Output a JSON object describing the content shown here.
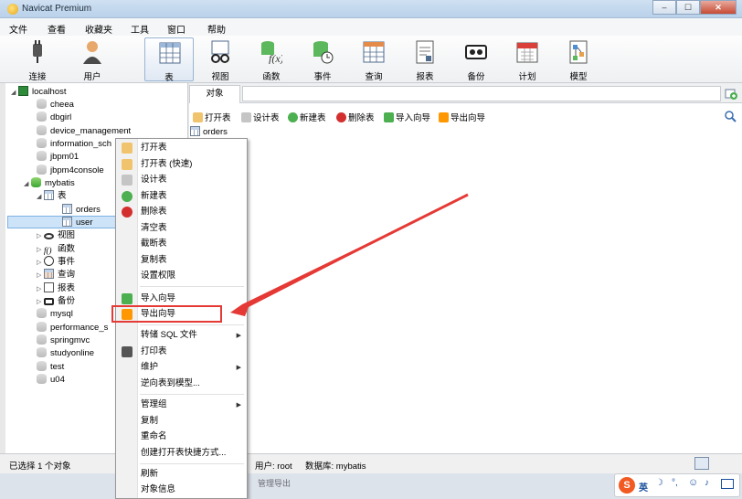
{
  "window": {
    "title": "Navicat Premium"
  },
  "menubar": [
    "文件",
    "查看",
    "收藏夹",
    "工具",
    "窗口",
    "帮助"
  ],
  "toolbar": [
    "连接",
    "用户",
    "表",
    "视图",
    "函数",
    "事件",
    "查询",
    "报表",
    "备份",
    "计划",
    "模型"
  ],
  "tree": {
    "root": "localhost",
    "databases_before": [
      "cheea",
      "dbgirl",
      "device_management",
      "information_sch",
      "jbpm01",
      "jbpm4console"
    ],
    "open_db": "mybatis",
    "tables_node": "表",
    "tables": [
      "orders",
      "user"
    ],
    "other_nodes": [
      "视图",
      "函数",
      "事件",
      "查询",
      "报表",
      "备份"
    ],
    "databases_after": [
      "mysql",
      "performance_s",
      "springmvc",
      "studyonline",
      "test",
      "u04"
    ]
  },
  "content": {
    "tab": "对象",
    "actions": [
      "打开表",
      "设计表",
      "新建表",
      "删除表",
      "导入向导",
      "导出向导"
    ],
    "table_item": "orders"
  },
  "context_menu": {
    "items": [
      "打开表",
      "打开表 (快速)",
      "设计表",
      "新建表",
      "删除表",
      "清空表",
      "截断表",
      "复制表",
      "设置权限",
      "导入向导",
      "导出向导",
      "转储 SQL 文件",
      "打印表",
      "维护",
      "逆向表到模型...",
      "管理组",
      "复制",
      "重命名",
      "创建打开表快捷方式...",
      "刷新",
      "对象信息"
    ]
  },
  "statusbar": {
    "selection": "已选择 1 个对象",
    "user": "用户: root",
    "database": "数据库: mybatis"
  },
  "taskbar": {
    "text": "管理导出"
  },
  "ime": {
    "lang": "英"
  },
  "colors": {
    "highlight_box": "#e53935",
    "arrow": "#e53935",
    "selection": "#cde3f7"
  }
}
